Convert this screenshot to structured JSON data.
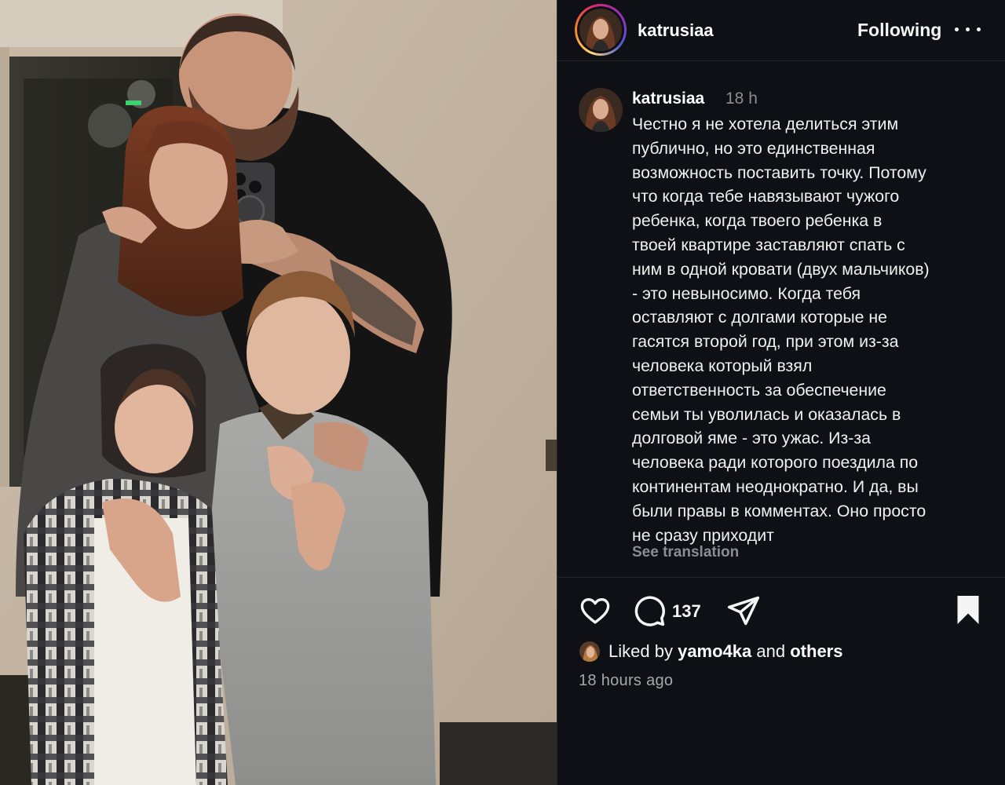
{
  "post": {
    "photo_alt": "family mirror selfie",
    "header": {
      "username": "katrusiaa",
      "follow_label": "Following",
      "more_icon": "more-horizontal-icon"
    },
    "caption": {
      "username": "katrusiaa",
      "time": "18 h",
      "text": "Честно я не хотела делиться этим\nпублично, но это единственная\nвозможность поставить точку. Потому\nчто когда тебе навязывают чужого\nребенка, когда твоего ребенка в\nтвоей квартире заставляют спать с\nним в одной кровати (двух мальчиков)\n- это невыносимо. Когда тебя\nоставляют с долгами которые не\nгасятся второй год, при этом из-за\nчеловека который взял\nответственность за обеспечение\nсемьи ты уволилась и оказалась в\nдолговой яме - это ужас. Из-за\nчеловека ради которого поездила по\nконтинентам неоднократно. И да, вы\nбыли правы в комментах. Оно просто\nне сразу приходит",
      "see_translation": "See translation"
    },
    "actions": {
      "like_icon": "heart-icon",
      "comment_icon": "comment-icon",
      "comment_count": "137",
      "share_icon": "share-icon",
      "save_icon": "bookmark-icon"
    },
    "likes": {
      "prefix": "Liked by",
      "user": "yamo4ka",
      "conj": "and",
      "others": "others"
    },
    "posted_ago": "18 hours ago"
  }
}
